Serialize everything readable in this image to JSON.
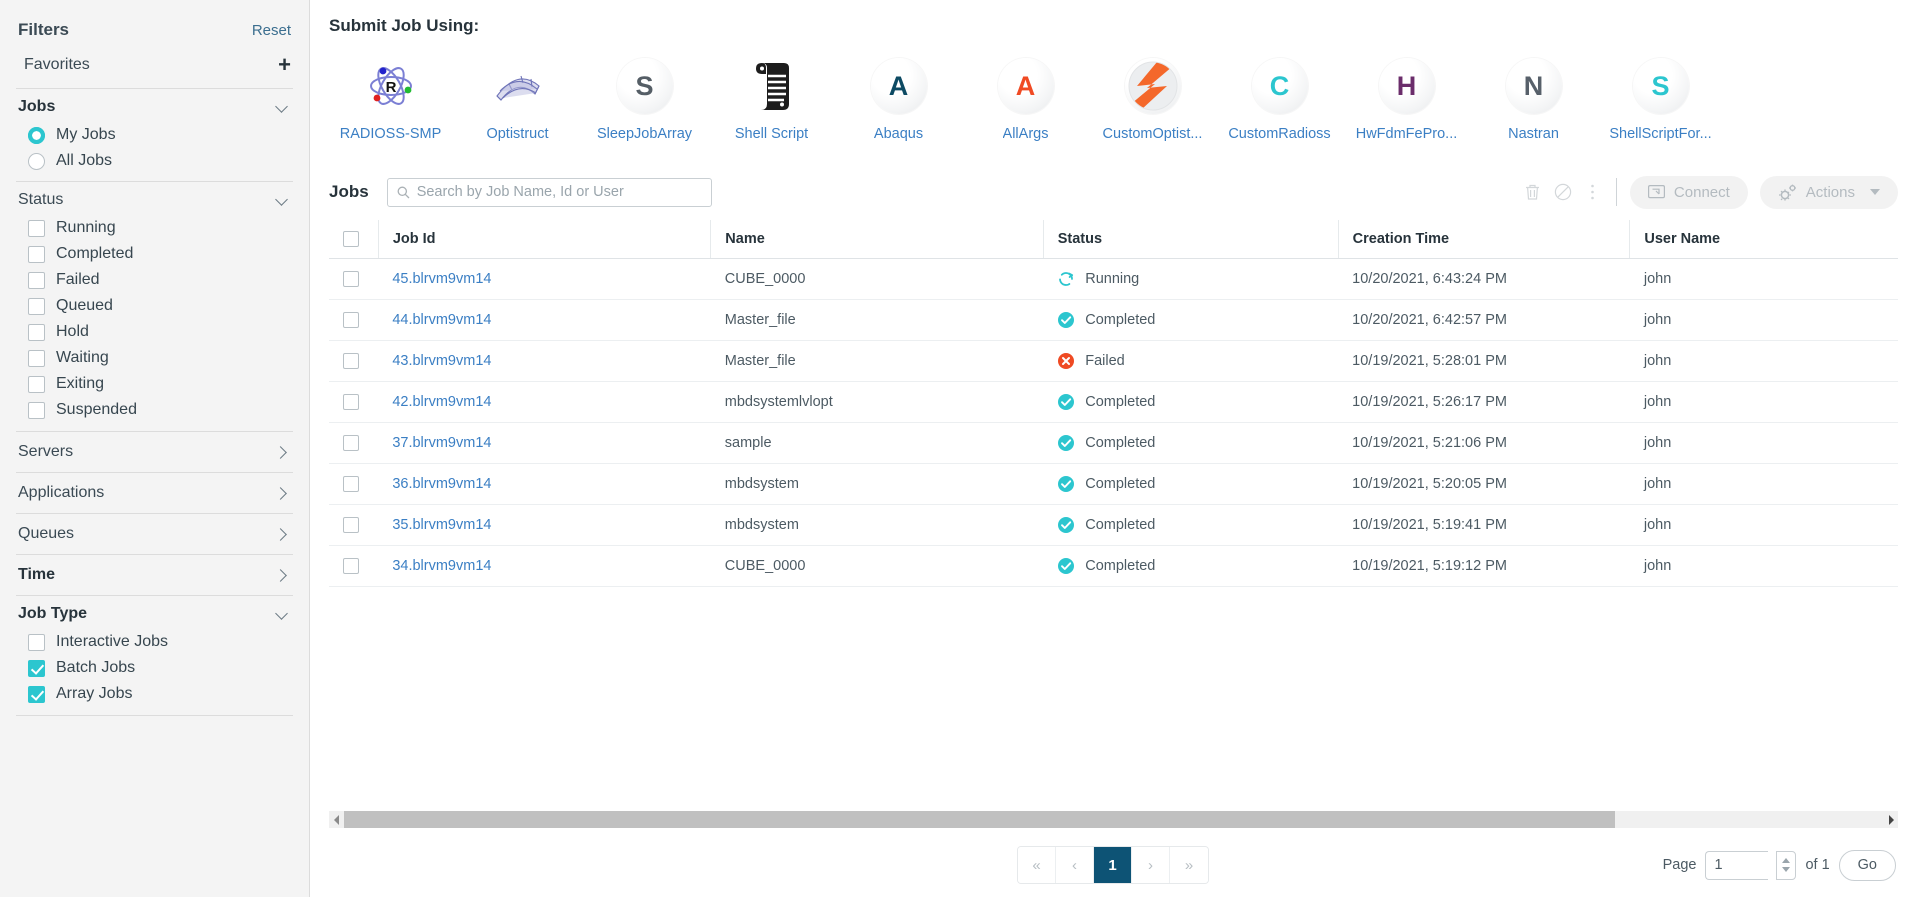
{
  "sidebar": {
    "title": "Filters",
    "reset_label": "Reset",
    "favorites_label": "Favorites",
    "add_favorite_icon": "plus-icon",
    "jobs_section": {
      "title": "Jobs",
      "options": [
        {
          "label": "My Jobs",
          "selected": true
        },
        {
          "label": "All Jobs",
          "selected": false
        }
      ]
    },
    "status_section": {
      "title": "Status",
      "options": [
        {
          "label": "Running",
          "checked": false
        },
        {
          "label": "Completed",
          "checked": false
        },
        {
          "label": "Failed",
          "checked": false
        },
        {
          "label": "Queued",
          "checked": false
        },
        {
          "label": "Hold",
          "checked": false
        },
        {
          "label": "Waiting",
          "checked": false
        },
        {
          "label": "Exiting",
          "checked": false
        },
        {
          "label": "Suspended",
          "checked": false
        }
      ]
    },
    "collapsed_sections": [
      {
        "label": "Servers",
        "bold": false
      },
      {
        "label": "Applications",
        "bold": false
      },
      {
        "label": "Queues",
        "bold": false
      },
      {
        "label": "Time",
        "bold": true
      }
    ],
    "job_type_section": {
      "title": "Job Type",
      "options": [
        {
          "label": "Interactive Jobs",
          "checked": false
        },
        {
          "label": "Batch Jobs",
          "checked": true
        },
        {
          "label": "Array Jobs",
          "checked": true
        }
      ]
    }
  },
  "submit": {
    "heading": "Submit Job Using:",
    "apps": [
      {
        "label": "RADIOSS-SMP",
        "icon": "radioss-atom-icon",
        "glyph": "",
        "color": "#7b7fd4"
      },
      {
        "label": "Optistruct",
        "icon": "optistruct-mesh-icon",
        "glyph": "",
        "color": "#8a8fc9"
      },
      {
        "label": "SleepJobArray",
        "icon": "letter-s-icon",
        "glyph": "S",
        "color": "#555e66"
      },
      {
        "label": "Shell Script",
        "icon": "scroll-icon",
        "glyph": "",
        "color": "#1d1d1d"
      },
      {
        "label": "Abaqus",
        "icon": "letter-a-icon",
        "glyph": "A",
        "color": "#0d4a63"
      },
      {
        "label": "AllArgs",
        "icon": "letter-a-icon",
        "glyph": "A",
        "color": "#f04a23"
      },
      {
        "label": "CustomOptist...",
        "icon": "altair-sphere-icon",
        "glyph": "",
        "color": "#f4682b"
      },
      {
        "label": "CustomRadioss",
        "icon": "letter-c-icon",
        "glyph": "C",
        "color": "#2cc6cf"
      },
      {
        "label": "HwFdmFePro...",
        "icon": "letter-h-icon",
        "glyph": "H",
        "color": "#6b2d6b"
      },
      {
        "label": "Nastran",
        "icon": "letter-n-icon",
        "glyph": "N",
        "color": "#57606a"
      },
      {
        "label": "ShellScriptFor...",
        "icon": "letter-s-icon",
        "glyph": "S",
        "color": "#2cc6cf"
      }
    ]
  },
  "jobs_panel": {
    "title": "Jobs",
    "search_placeholder": "Search by Job Name, Id or User",
    "search_value": "",
    "toolbar_icons": [
      {
        "name": "delete-icon"
      },
      {
        "name": "cancel-icon"
      },
      {
        "name": "more-options-icon"
      }
    ],
    "connect_label": "Connect",
    "actions_label": "Actions",
    "columns": [
      "Job Id",
      "Name",
      "Status",
      "Creation Time",
      "User Name"
    ],
    "rows": [
      {
        "job_id": "45.blrvm9vm14",
        "name": "CUBE_0000",
        "status": "Running",
        "status_type": "running",
        "creation_time": "10/20/2021, 6:43:24 PM",
        "user_name": "john"
      },
      {
        "job_id": "44.blrvm9vm14",
        "name": "Master_file",
        "status": "Completed",
        "status_type": "completed",
        "creation_time": "10/20/2021, 6:42:57 PM",
        "user_name": "john"
      },
      {
        "job_id": "43.blrvm9vm14",
        "name": "Master_file",
        "status": "Failed",
        "status_type": "failed",
        "creation_time": "10/19/2021, 5:28:01 PM",
        "user_name": "john"
      },
      {
        "job_id": "42.blrvm9vm14",
        "name": "mbdsystemlvlopt",
        "status": "Completed",
        "status_type": "completed",
        "creation_time": "10/19/2021, 5:26:17 PM",
        "user_name": "john"
      },
      {
        "job_id": "37.blrvm9vm14",
        "name": "sample",
        "status": "Completed",
        "status_type": "completed",
        "creation_time": "10/19/2021, 5:21:06 PM",
        "user_name": "john"
      },
      {
        "job_id": "36.blrvm9vm14",
        "name": "mbdsystem",
        "status": "Completed",
        "status_type": "completed",
        "creation_time": "10/19/2021, 5:20:05 PM",
        "user_name": "john"
      },
      {
        "job_id": "35.blrvm9vm14",
        "name": "mbdsystem",
        "status": "Completed",
        "status_type": "completed",
        "creation_time": "10/19/2021, 5:19:41 PM",
        "user_name": "john"
      },
      {
        "job_id": "34.blrvm9vm14",
        "name": "CUBE_0000",
        "status": "Completed",
        "status_type": "completed",
        "creation_time": "10/19/2021, 5:19:12 PM",
        "user_name": "john"
      }
    ]
  },
  "pagination": {
    "first_label": "«",
    "prev_label": "‹",
    "current_page": "1",
    "next_label": "›",
    "last_label": "»",
    "page_label": "Page",
    "page_input_value": "1",
    "of_label": "of 1",
    "go_label": "Go"
  },
  "colors": {
    "accent_teal": "#2cc6cf",
    "link_blue": "#3b7fc4",
    "failed_red": "#ef4a23",
    "active_page": "#0d5375"
  }
}
